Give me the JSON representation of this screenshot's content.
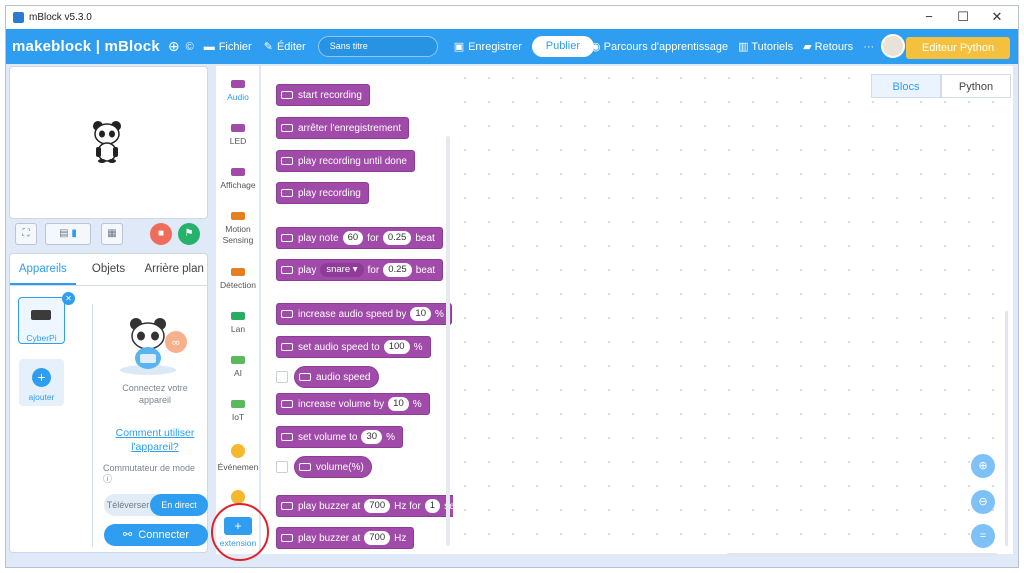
{
  "window": {
    "title": "mBlock v5.3.0",
    "controls": [
      "−",
      "☐",
      "✕"
    ]
  },
  "topbar": {
    "brand": "makeblock | mBlock",
    "file": "Fichier",
    "edit": "Éditer",
    "project_title": "Sans titre",
    "save": "Enregistrer",
    "publish": "Publier",
    "learning": "Parcours d'apprentissage",
    "tutorials": "Tutoriels",
    "feedback": "Retours",
    "more": "···",
    "python_editor": "Editeur Python"
  },
  "sprites_panel": {
    "tabs": [
      "Appareils",
      "Objets",
      "Arrière plan"
    ],
    "device_label": "CyberPi",
    "add_label": "ajouter",
    "connect_text": "Connectez votre appareil",
    "how_to": "Comment utiliser l'appareil?",
    "switch_label": "Commutateur de mode",
    "mode_upload": "Téléverser",
    "mode_live": "En direct",
    "connect_button": "Connecter"
  },
  "categories": [
    {
      "label": "Audio",
      "color": "#a04ba9"
    },
    {
      "label": "LED",
      "color": "#a04ba9"
    },
    {
      "label": "Affichage",
      "color": "#a04ba9"
    },
    {
      "label": "Motion Sensing",
      "color": "#e67e22"
    },
    {
      "label": "Détection",
      "color": "#e67e22"
    },
    {
      "label": "Lan",
      "color": "#27ae60"
    },
    {
      "label": "AI",
      "color": "#5cb85c"
    },
    {
      "label": "IoT",
      "color": "#5cb85c"
    },
    {
      "label": "Événemen",
      "color": "#f5b82e"
    },
    {
      "label": "",
      "color": "#f5b82e"
    }
  ],
  "extension_label": "extension",
  "blocks": {
    "b0": "start recording",
    "b1": "arrêter l'enregistrement",
    "b2": "play recording until done",
    "b3": "play recording",
    "b4": {
      "a": "play note",
      "v1": "60",
      "b": "for",
      "v2": "0.25",
      "c": "beat"
    },
    "b5": {
      "a": "play",
      "v1": "snare ▾",
      "b": "for",
      "v2": "0.25",
      "c": "beat"
    },
    "b6": {
      "a": "increase audio speed by",
      "v1": "10",
      "c": "%"
    },
    "b7": {
      "a": "set audio speed to",
      "v1": "100",
      "c": "%"
    },
    "b8": "audio speed",
    "b9": {
      "a": "increase volume by",
      "v1": "10",
      "c": "%"
    },
    "b10": {
      "a": "set volume to",
      "v1": "30",
      "c": "%"
    },
    "b11": "volume(%)",
    "b12": {
      "a": "play buzzer at",
      "v1": "700",
      "b": "Hz for",
      "v2": "1",
      "c": "secs"
    },
    "b13": {
      "a": "play buzzer at",
      "v1": "700",
      "c": "Hz"
    }
  },
  "view_tabs": [
    "Blocs",
    "Python"
  ]
}
